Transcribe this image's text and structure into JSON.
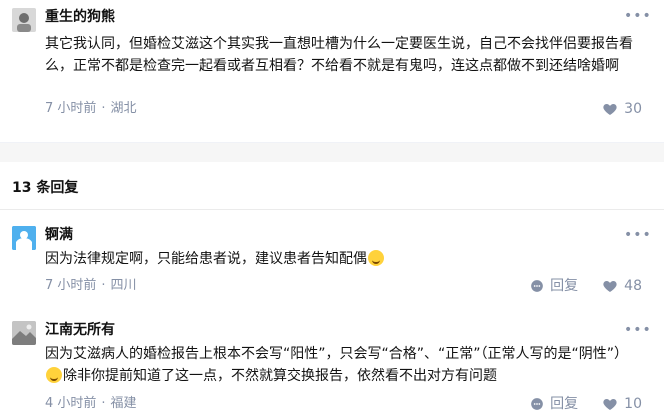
{
  "comments_top": [
    {
      "author": "重生的狗熊",
      "content": "其它我认同，但婚检艾滋这个其实我一直想吐槽为什么一定要医生说，自己不会找伴侣要报告看么，正常不都是检查完一起看或者互相看？不给看不就是有鬼吗，连这点都做不到还结啥婚啊",
      "time": "7 小时前",
      "location": "湖北",
      "likes": "30",
      "avatar_color": "#8a8a8a"
    }
  ],
  "replies_header": "13 条回复",
  "replies": [
    {
      "author": "锕满",
      "content_before": "因为法律规定啊，只能给患者说，建议患者告知配偶",
      "content_after": "",
      "time": "7 小时前",
      "location": "四川",
      "reply_label": "回复",
      "likes": "48",
      "avatar_color": "#3da0e0"
    },
    {
      "author": "江南无所有",
      "content_before": "因为艾滋病人的婚检报告上根本不会写“阳性”，只会写“合格”、“正常”（正常人写的是“阴性”）",
      "content_after": "除非你提前知道了这一点，不然就算交换报告，依然看不出对方有问题",
      "time": "4 小时前",
      "location": "福建",
      "reply_label": "回复",
      "likes": "10",
      "avatar_color": "#9a9a9a"
    }
  ],
  "icons": {
    "more": "more-horizontal-icon",
    "like": "heart-icon",
    "reply": "reply-bubble-icon",
    "emoji": "laugh-cry-emoji-icon"
  },
  "colors": {
    "text": "#121212",
    "meta": "#8590a6",
    "gap": "#f6f6f6"
  },
  "separator": "·"
}
